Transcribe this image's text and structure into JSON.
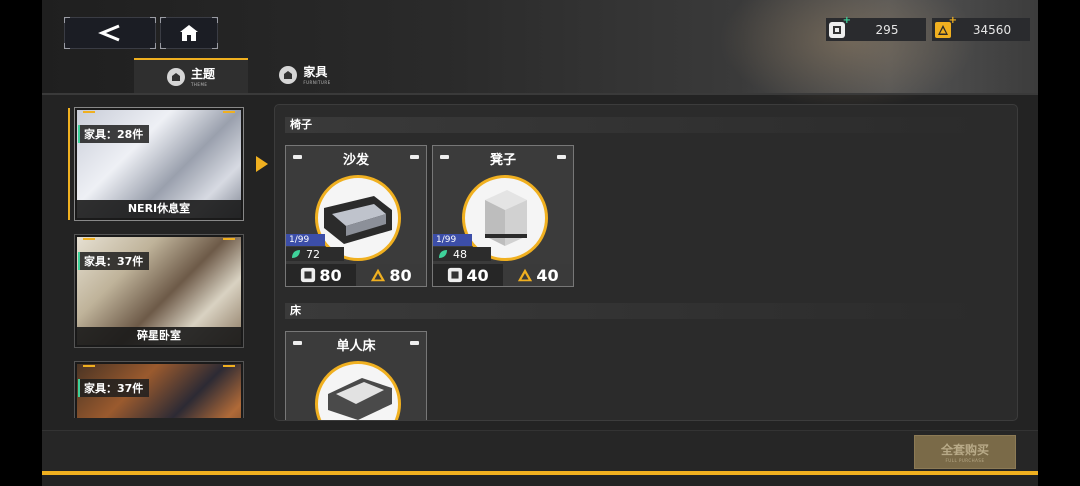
{
  "nav": {
    "back_icon": "chevron-left-icon",
    "home_icon": "house-icon"
  },
  "currency": [
    {
      "icon": "green-gem-icon",
      "value": "295",
      "color": "#3fd29a"
    },
    {
      "icon": "gold-triangle-icon",
      "value": "34560",
      "color": "#f0b020"
    }
  ],
  "tabs": [
    {
      "label": "主题",
      "sub": "THEME",
      "active": true
    },
    {
      "label": "家具",
      "sub": "FURNITURE",
      "active": false
    }
  ],
  "rooms": [
    {
      "count": "家具：28件",
      "name": "NERI休息室",
      "active": true
    },
    {
      "count": "家具：37件",
      "name": "碎星卧室",
      "active": false
    },
    {
      "count": "家具：37件",
      "name": "",
      "active": false
    }
  ],
  "categories": [
    {
      "title": "椅子",
      "items": [
        {
          "name": "沙发",
          "stock": "1/99",
          "green": "72",
          "price_a": "80",
          "price_b": "80"
        },
        {
          "name": "凳子",
          "stock": "1/99",
          "green": "48",
          "price_a": "40",
          "price_b": "40"
        }
      ]
    },
    {
      "title": "床",
      "items": [
        {
          "name": "单人床"
        }
      ]
    }
  ],
  "buy_all": {
    "label": "全套购买",
    "sub": "FULL PURCHASE"
  },
  "colors": {
    "accent": "#f0b020",
    "green": "#3fd29a",
    "blue": "#3c4ea8"
  }
}
